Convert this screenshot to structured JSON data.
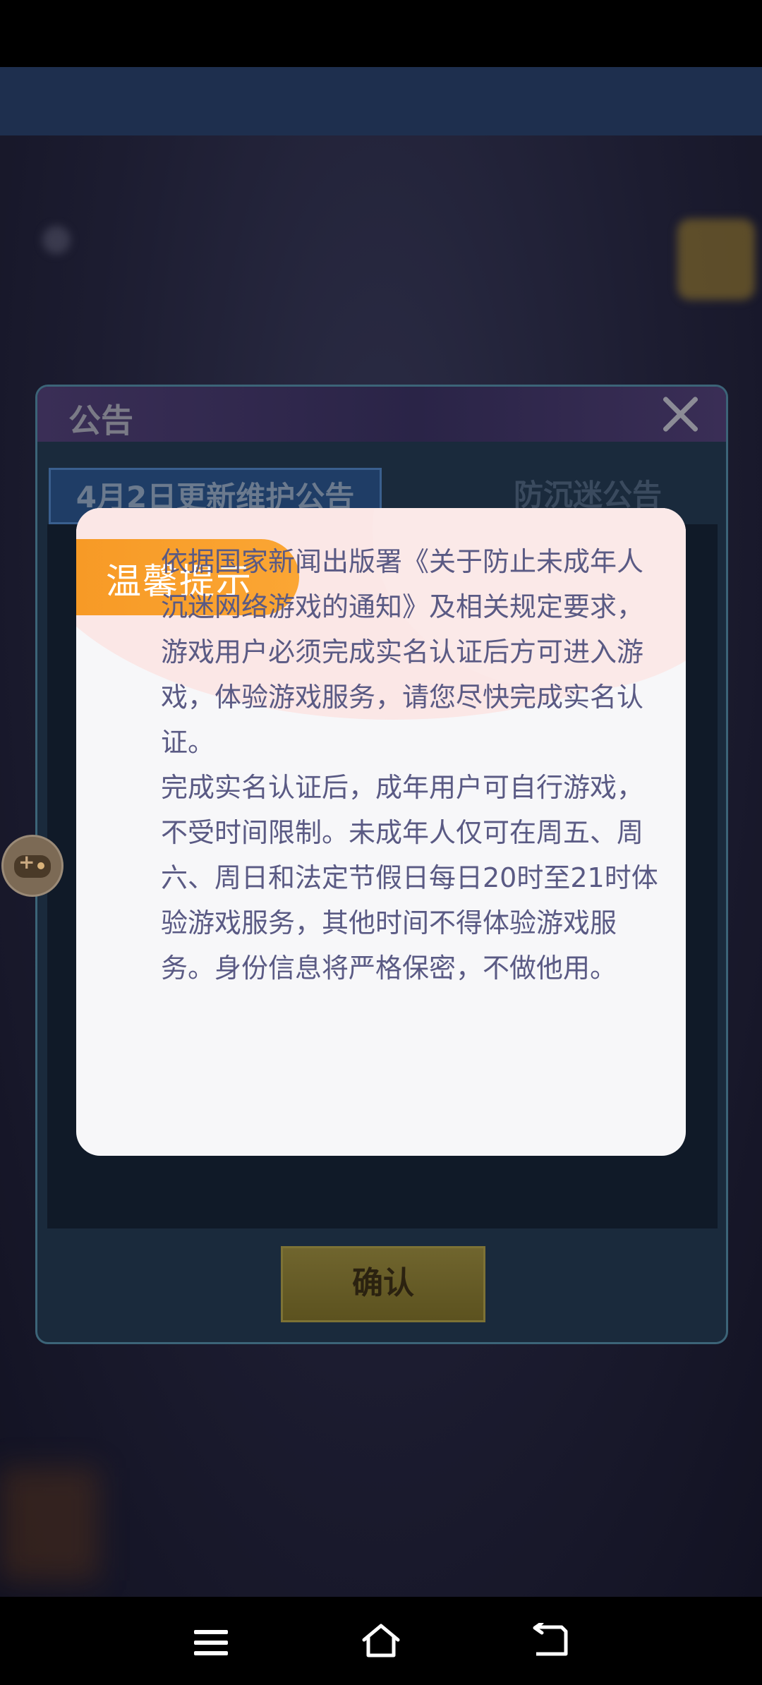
{
  "panel": {
    "title": "公告",
    "tabs": [
      {
        "label": "4月2日更新维护公告"
      },
      {
        "label": "防沉迷公告"
      }
    ],
    "confirm_label": "确认"
  },
  "dialog": {
    "badge": "温馨提示",
    "body": "依据国家新闻出版署《关于防止未成年人沉迷网络游戏的通知》及相关规定要求，游戏用户必须完成实名认证后方可进入游戏，体验游戏服务，请您尽快完成实名认证。\n完成实名认证后，成年用户可自行游戏，不受时间限制。未成年人仅可在周五、周六、周日和法定节假日每日20时至21时体验游戏服务，其他时间不得体验游戏服务。身份信息将严格保密，不做他用。"
  },
  "icons": {
    "close": "close-icon",
    "floating": "gamepad-icon",
    "nav": [
      "menu-icon",
      "home-icon",
      "back-icon"
    ]
  },
  "colors": {
    "badge": "#f79a26",
    "dialog_text": "#5a5a84",
    "dialog_bg": "#f7f7f9"
  }
}
